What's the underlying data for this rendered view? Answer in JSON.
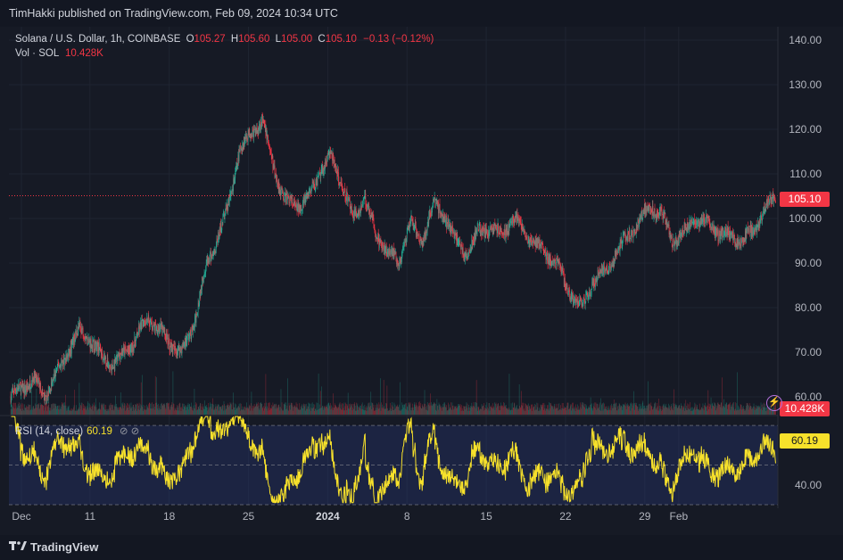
{
  "header": {
    "published": "TimHakki published on TradingView.com, Feb 09, 2024 10:34 UTC"
  },
  "legend": {
    "symbol": "Solana / U.S. Dollar, 1h, COINBASE",
    "o_label": "O",
    "o": "105.27",
    "h_label": "H",
    "h": "105.60",
    "l_label": "L",
    "l": "105.00",
    "c_label": "C",
    "c": "105.10",
    "change": "−0.13 (−0.12%)",
    "vol_label": "Vol · SOL",
    "vol": "10.428K"
  },
  "rsi_legend": {
    "label": "RSI (14, close)",
    "value": "60.19",
    "icons": "⊘ ⊘"
  },
  "price_tags": {
    "last": "105.10",
    "volume": "10.428K",
    "rsi": "60.19"
  },
  "footer": {
    "brand": "TradingView"
  },
  "colors": {
    "up": "#22ab94",
    "down": "#f23645",
    "rsi_line": "#f7e12b",
    "background": "#161a25"
  },
  "chart_data": {
    "type": "candlestick",
    "symbol": "Solana / U.S. Dollar",
    "interval": "1h",
    "exchange": "COINBASE",
    "y_ticks": [
      "140.00",
      "130.00",
      "120.00",
      "110.00",
      "100.00",
      "90.00",
      "80.00",
      "70.00",
      "60.00"
    ],
    "ylim": [
      56,
      143
    ],
    "x_ticks": [
      "Dec",
      "11",
      "18",
      "25",
      "2024",
      "8",
      "15",
      "22",
      "29",
      "Feb"
    ],
    "x_ticks_bold": [
      "2024"
    ],
    "last_price": 105.1,
    "price_path": [
      {
        "date": "2023-12-04",
        "close": 60
      },
      {
        "date": "2023-12-05",
        "close": 62
      },
      {
        "date": "2023-12-06",
        "close": 64
      },
      {
        "date": "2023-12-07",
        "close": 60
      },
      {
        "date": "2023-12-08",
        "close": 65
      },
      {
        "date": "2023-12-09",
        "close": 70
      },
      {
        "date": "2023-12-10",
        "close": 75
      },
      {
        "date": "2023-12-11",
        "close": 73
      },
      {
        "date": "2023-12-12",
        "close": 69
      },
      {
        "date": "2023-12-13",
        "close": 67
      },
      {
        "date": "2023-12-14",
        "close": 70
      },
      {
        "date": "2023-12-15",
        "close": 73
      },
      {
        "date": "2023-12-16",
        "close": 78
      },
      {
        "date": "2023-12-17",
        "close": 75
      },
      {
        "date": "2023-12-18",
        "close": 72
      },
      {
        "date": "2023-12-19",
        "close": 70
      },
      {
        "date": "2023-12-20",
        "close": 76
      },
      {
        "date": "2023-12-21",
        "close": 88
      },
      {
        "date": "2023-12-22",
        "close": 95
      },
      {
        "date": "2023-12-23",
        "close": 102
      },
      {
        "date": "2023-12-24",
        "close": 115
      },
      {
        "date": "2023-12-25",
        "close": 119
      },
      {
        "date": "2023-12-26",
        "close": 122
      },
      {
        "date": "2023-12-27",
        "close": 112
      },
      {
        "date": "2023-12-28",
        "close": 104
      },
      {
        "date": "2023-12-29",
        "close": 103
      },
      {
        "date": "2023-12-30",
        "close": 104
      },
      {
        "date": "2023-12-31",
        "close": 110
      },
      {
        "date": "2024-01-01",
        "close": 114
      },
      {
        "date": "2024-01-02",
        "close": 108
      },
      {
        "date": "2024-01-03",
        "close": 100
      },
      {
        "date": "2024-01-04",
        "close": 105
      },
      {
        "date": "2024-01-05",
        "close": 96
      },
      {
        "date": "2024-01-06",
        "close": 93
      },
      {
        "date": "2024-01-07",
        "close": 90
      },
      {
        "date": "2024-01-08",
        "close": 99
      },
      {
        "date": "2024-01-09",
        "close": 95
      },
      {
        "date": "2024-01-10",
        "close": 103
      },
      {
        "date": "2024-01-11",
        "close": 101
      },
      {
        "date": "2024-01-12",
        "close": 95
      },
      {
        "date": "2024-01-13",
        "close": 92
      },
      {
        "date": "2024-01-14",
        "close": 97
      },
      {
        "date": "2024-01-15",
        "close": 98
      },
      {
        "date": "2024-01-16",
        "close": 96
      },
      {
        "date": "2024-01-17",
        "close": 100
      },
      {
        "date": "2024-01-18",
        "close": 97
      },
      {
        "date": "2024-01-19",
        "close": 94
      },
      {
        "date": "2024-01-20",
        "close": 92
      },
      {
        "date": "2024-01-21",
        "close": 89
      },
      {
        "date": "2024-01-22",
        "close": 83
      },
      {
        "date": "2024-01-23",
        "close": 80
      },
      {
        "date": "2024-01-24",
        "close": 86
      },
      {
        "date": "2024-01-25",
        "close": 88
      },
      {
        "date": "2024-01-26",
        "close": 92
      },
      {
        "date": "2024-01-27",
        "close": 96
      },
      {
        "date": "2024-01-28",
        "close": 99
      },
      {
        "date": "2024-01-29",
        "close": 103
      },
      {
        "date": "2024-01-30",
        "close": 101
      },
      {
        "date": "2024-01-31",
        "close": 95
      },
      {
        "date": "2024-02-01",
        "close": 97
      },
      {
        "date": "2024-02-02",
        "close": 100
      },
      {
        "date": "2024-02-03",
        "close": 99
      },
      {
        "date": "2024-02-04",
        "close": 97
      },
      {
        "date": "2024-02-05",
        "close": 96
      },
      {
        "date": "2024-02-06",
        "close": 95
      },
      {
        "date": "2024-02-07",
        "close": 97
      },
      {
        "date": "2024-02-08",
        "close": 102
      },
      {
        "date": "2024-02-09",
        "close": 105.1
      }
    ],
    "rsi": {
      "name": "RSI (14, close)",
      "ylim": [
        30,
        75
      ],
      "y_ticks": [
        "40.00"
      ],
      "band_upper": 70,
      "band_lower": 30,
      "last": 60.19
    }
  }
}
